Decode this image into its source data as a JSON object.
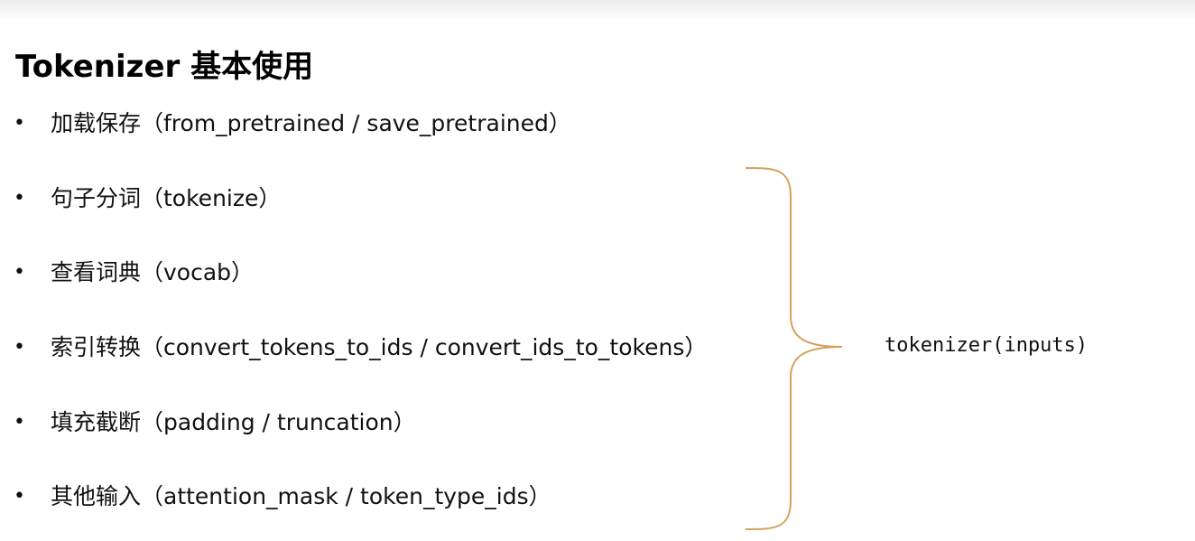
{
  "slide": {
    "title": "Tokenizer 基本使用",
    "bullet_symbol": "•",
    "items": [
      {
        "label": "加载保存（from_pretrained / save_pretrained）"
      },
      {
        "label": "句子分词（tokenize）"
      },
      {
        "label": "查看词典（vocab）"
      },
      {
        "label": "索引转换（convert_tokens_to_ids / convert_ids_to_tokens）"
      },
      {
        "label": "填充截断（padding / truncation）"
      },
      {
        "label": "其他输入（attention_mask / token_type_ids）"
      }
    ],
    "brace_color": "#d6a15c",
    "call_label": "tokenizer(inputs)"
  }
}
